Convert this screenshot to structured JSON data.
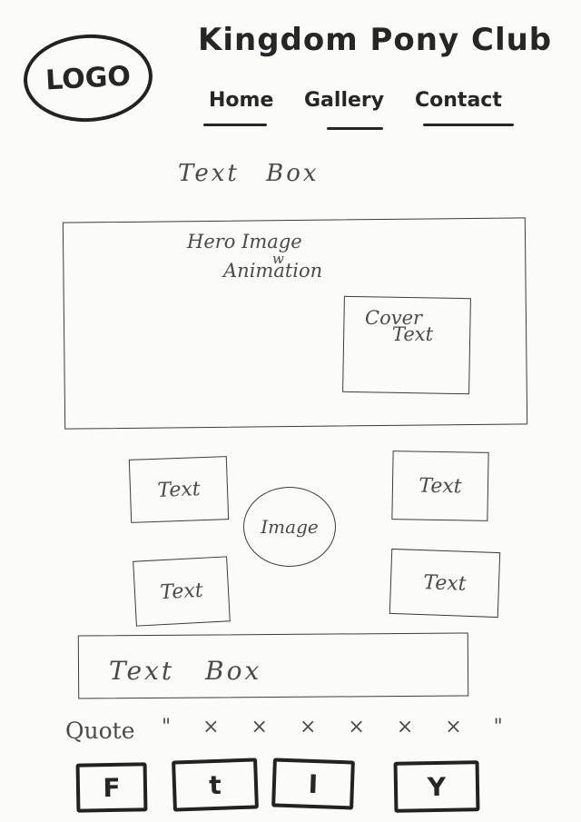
{
  "header": {
    "logo": "LOGO",
    "title": "Kingdom Pony Club"
  },
  "nav": {
    "home": "Home",
    "gallery": "Gallery",
    "contact": "Contact"
  },
  "intro_text_box": "Text Box",
  "hero": {
    "label": "Hero Image",
    "sub_w": "w",
    "sub_animation": "Animation",
    "cover_line1": "Cover",
    "cover_line2": "Text"
  },
  "features": {
    "top_left": "Text",
    "top_right": "Text",
    "bottom_left": "Text",
    "bottom_right": "Text",
    "center_image": "Image"
  },
  "text_box_wide": "Text Box",
  "quote": {
    "label": "Quote",
    "content": "\" × × × × × × \""
  },
  "social": [
    "F",
    "t",
    "I",
    "Y"
  ]
}
